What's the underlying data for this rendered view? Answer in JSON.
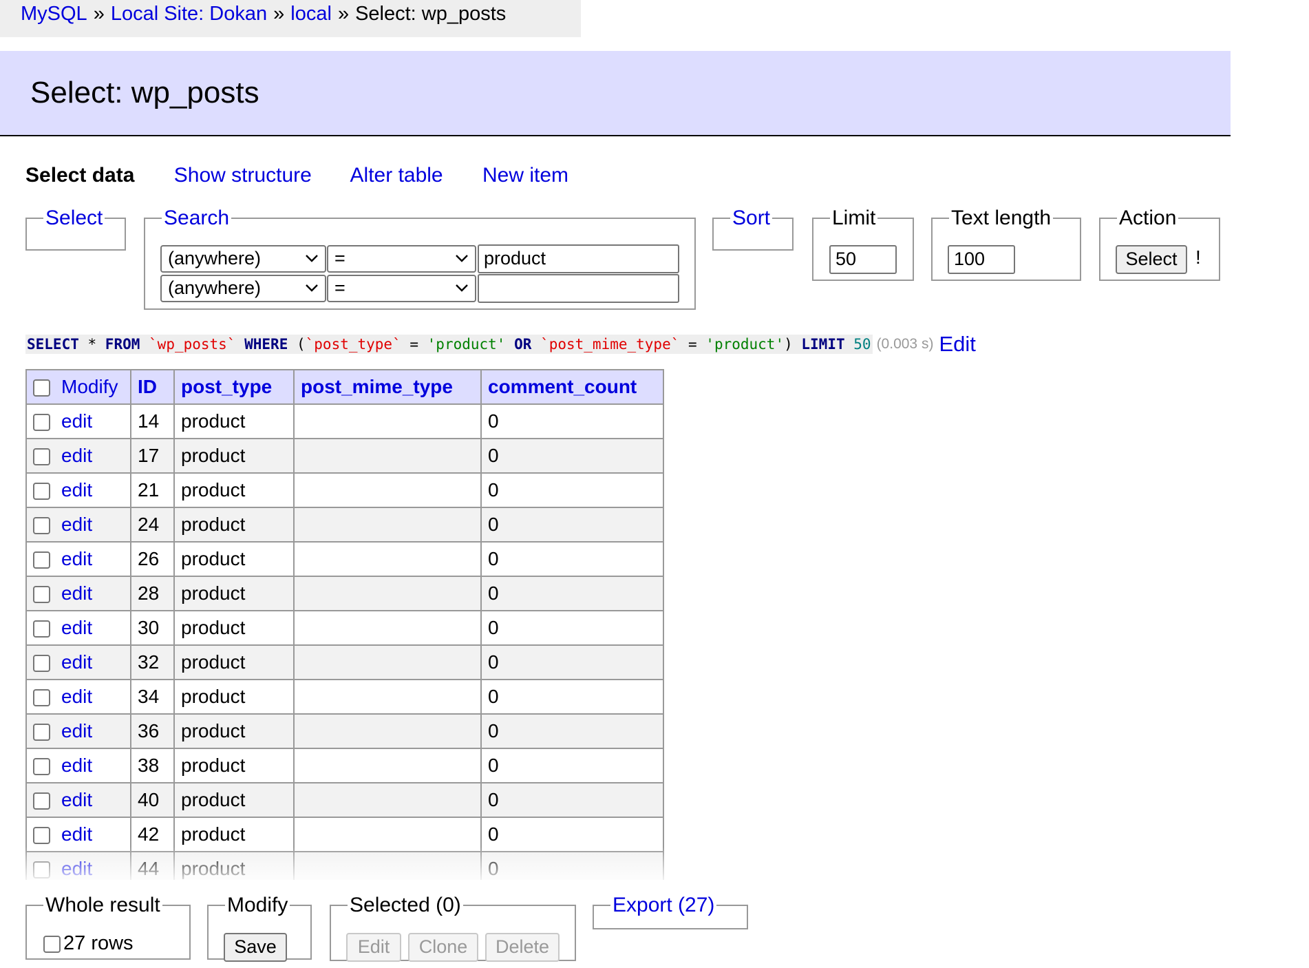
{
  "breadcrumb": {
    "items": [
      "MySQL",
      "Local Site: Dokan",
      "local"
    ],
    "separator": "»",
    "current": "Select: wp_posts"
  },
  "header": {
    "title": "Select: wp_posts"
  },
  "nav": {
    "select_data": "Select data",
    "show_structure": "Show structure",
    "alter_table": "Alter table",
    "new_item": "New item"
  },
  "form": {
    "select_legend": "Select",
    "search_legend": "Search",
    "search_rows": [
      {
        "column": "(anywhere)",
        "operator": "=",
        "value": "product"
      },
      {
        "column": "(anywhere)",
        "operator": "=",
        "value": ""
      }
    ],
    "sort_legend": "Sort",
    "limit_legend": "Limit",
    "limit_value": "50",
    "text_length_legend": "Text length",
    "text_length_value": "100",
    "action_legend": "Action",
    "select_button": "Select",
    "action_bang": "!"
  },
  "query": {
    "tokens": [
      {
        "t": "SELECT",
        "c": "kw"
      },
      {
        "t": " * ",
        "c": "op"
      },
      {
        "t": "FROM",
        "c": "kw"
      },
      {
        "t": " ",
        "c": "op"
      },
      {
        "t": "`wp_posts`",
        "c": "id"
      },
      {
        "t": " ",
        "c": "op"
      },
      {
        "t": "WHERE",
        "c": "kw"
      },
      {
        "t": " (",
        "c": "op"
      },
      {
        "t": "`post_type`",
        "c": "id"
      },
      {
        "t": " = ",
        "c": "op"
      },
      {
        "t": "'product'",
        "c": "str"
      },
      {
        "t": " ",
        "c": "op"
      },
      {
        "t": "OR",
        "c": "kw"
      },
      {
        "t": " ",
        "c": "op"
      },
      {
        "t": "`post_mime_type`",
        "c": "id"
      },
      {
        "t": " = ",
        "c": "op"
      },
      {
        "t": "'product'",
        "c": "str"
      },
      {
        "t": ") ",
        "c": "op"
      },
      {
        "t": "LIMIT",
        "c": "kw"
      },
      {
        "t": " ",
        "c": "op"
      },
      {
        "t": "50",
        "c": "num"
      }
    ],
    "time": "(0.003 s)",
    "edit_link": "Edit"
  },
  "table": {
    "columns": [
      "Modify",
      "ID",
      "post_type",
      "post_mime_type",
      "comment_count"
    ],
    "edit_label": "edit",
    "rows": [
      {
        "id": "14",
        "post_type": "product",
        "post_mime_type": "",
        "comment_count": "0"
      },
      {
        "id": "17",
        "post_type": "product",
        "post_mime_type": "",
        "comment_count": "0"
      },
      {
        "id": "21",
        "post_type": "product",
        "post_mime_type": "",
        "comment_count": "0"
      },
      {
        "id": "24",
        "post_type": "product",
        "post_mime_type": "",
        "comment_count": "0"
      },
      {
        "id": "26",
        "post_type": "product",
        "post_mime_type": "",
        "comment_count": "0"
      },
      {
        "id": "28",
        "post_type": "product",
        "post_mime_type": "",
        "comment_count": "0"
      },
      {
        "id": "30",
        "post_type": "product",
        "post_mime_type": "",
        "comment_count": "0"
      },
      {
        "id": "32",
        "post_type": "product",
        "post_mime_type": "",
        "comment_count": "0"
      },
      {
        "id": "34",
        "post_type": "product",
        "post_mime_type": "",
        "comment_count": "0"
      },
      {
        "id": "36",
        "post_type": "product",
        "post_mime_type": "",
        "comment_count": "0"
      },
      {
        "id": "38",
        "post_type": "product",
        "post_mime_type": "",
        "comment_count": "0"
      },
      {
        "id": "40",
        "post_type": "product",
        "post_mime_type": "",
        "comment_count": "0"
      },
      {
        "id": "42",
        "post_type": "product",
        "post_mime_type": "",
        "comment_count": "0"
      },
      {
        "id": "44",
        "post_type": "product",
        "post_mime_type": "",
        "comment_count": "0"
      }
    ]
  },
  "bottom": {
    "whole_result_legend": "Whole result",
    "rows_label": "27 rows",
    "modify_legend": "Modify",
    "save_button": "Save",
    "selected_legend": "Selected (0)",
    "edit_button": "Edit",
    "clone_button": "Clone",
    "delete_button": "Delete",
    "export_legend": "Export (27)"
  },
  "colors": {
    "link": "#0000dd",
    "header_bg": "#ddddff",
    "breadcrumb_bg": "#eeeeee",
    "sql_keyword": "#000080",
    "sql_identifier": "#e00000",
    "sql_string": "#008000",
    "sql_number": "#008080"
  },
  "icons": {
    "select_arrow": "chevron-down-icon",
    "checkbox": "checkbox-icon"
  }
}
